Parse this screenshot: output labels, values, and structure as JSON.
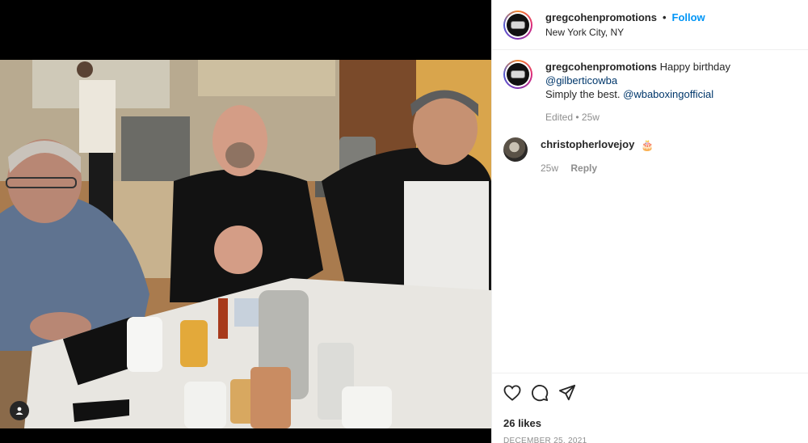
{
  "header": {
    "username": "gregcohenpromotions",
    "separator": "•",
    "follow_label": "Follow",
    "location": "New York City, NY"
  },
  "caption": {
    "username": "gregcohenpromotions",
    "text_1": "Happy birthday",
    "mention_1": "@gilberticowba",
    "text_2": "Simply the best.",
    "mention_2": "@wbaboxingofficial",
    "meta": "Edited • 25w"
  },
  "comments": [
    {
      "username": "christopherlovejoy",
      "emoji": "🎂",
      "time": "25w",
      "reply_label": "Reply"
    }
  ],
  "actions": {
    "like_icon": "heart-icon",
    "comment_icon": "comment-icon",
    "share_icon": "share-icon"
  },
  "stats": {
    "likes": "26 likes",
    "date": "DECEMBER 25, 2021"
  },
  "colors": {
    "accent": "#0095f6",
    "mention": "#00376b",
    "muted": "#8e8e8e"
  }
}
